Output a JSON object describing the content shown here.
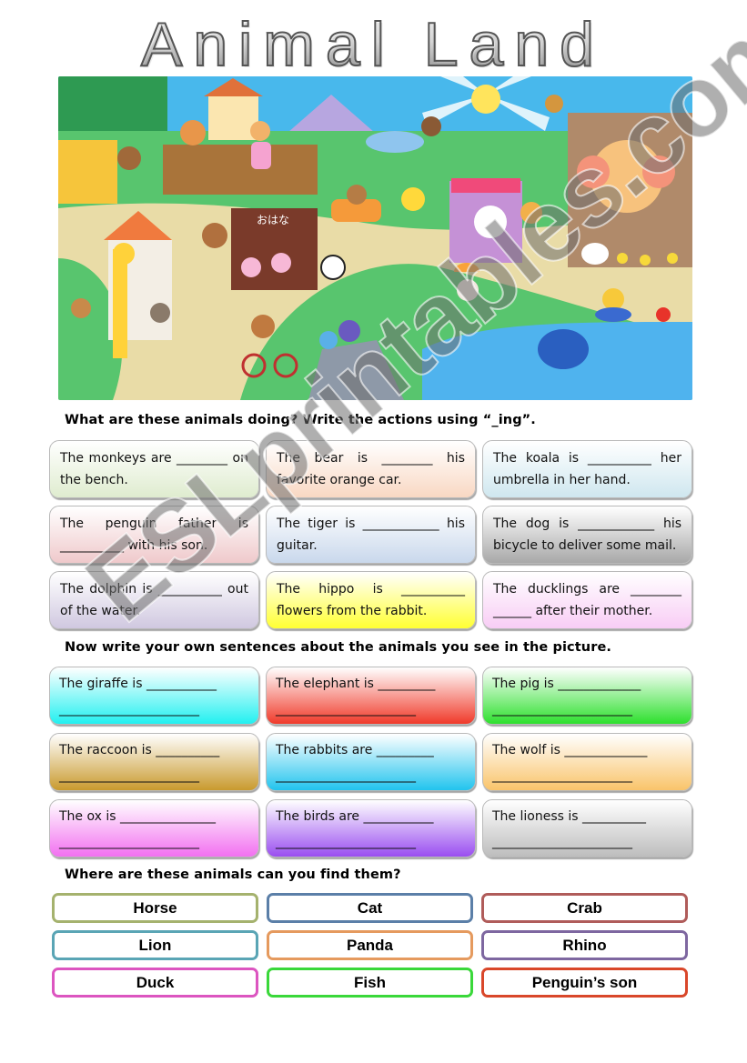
{
  "title": "Animal Land",
  "illustration": {
    "description": "Cartoon town scene with animals",
    "sign_text": "おはな"
  },
  "section1": {
    "heading": "What are these animals doing? Write the actions using “_ing”.",
    "cards": [
      {
        "text": "The monkeys are ________ on the bench.",
        "color": "#dfeccf"
      },
      {
        "text": "The bear is ________ his favorite orange car.",
        "color": "#f9d8c3"
      },
      {
        "text": "The koala is __________ her umbrella in her hand.",
        "color": "#cfe7ef"
      },
      {
        "text": "The penguin father is __________ with his son.",
        "color": "#efc9cb"
      },
      {
        "text": "The tiger is ____________ his guitar.",
        "color": "#c9d8ec"
      },
      {
        "text": "The dog is ____________ his bicycle to deliver some mail.",
        "color": "#a8a8a8"
      },
      {
        "text": "The dolphin is __________ out of the water.",
        "color": "#d0c8e0"
      },
      {
        "text": "The hippo is __________ flowers from the rabbit.",
        "color": "#ffff33"
      },
      {
        "text": "The ducklings are ________ ______ after their mother.",
        "color": "#f8cdf5"
      }
    ]
  },
  "section2": {
    "heading": "Now write your own sentences about the animals you see in the picture.",
    "cards": [
      {
        "line1": "The giraffe is ___________",
        "line2": "______________________",
        "color": "#22f0f0"
      },
      {
        "line1": "The elephant is _________",
        "line2": "______________________",
        "color": "#f03a2a"
      },
      {
        "line1": "The pig is _____________",
        "line2": "______________________",
        "color": "#2ee02e"
      },
      {
        "line1": "The raccoon is __________",
        "line2": "______________________",
        "color": "#c99a2e"
      },
      {
        "line1": "The rabbits are _________",
        "line2": "______________________",
        "color": "#22c4ee"
      },
      {
        "line1": "The wolf is _____________",
        "line2": "______________________",
        "color": "#f9c46a"
      },
      {
        "line1": "The ox is _______________",
        "line2": "______________________",
        "color": "#f270f0"
      },
      {
        "line1": "The birds are ___________",
        "line2": "______________________",
        "color": "#9a4ef0"
      },
      {
        "line1": "The lioness is __________",
        "line2": "______________________",
        "color": "#bdbdbd"
      }
    ]
  },
  "section3": {
    "heading": "Where are these animals can you find them?",
    "words": [
      {
        "label": "Horse",
        "border": "#a5b26e"
      },
      {
        "label": "Cat",
        "border": "#5b7fa8"
      },
      {
        "label": "Crab",
        "border": "#b05c5a"
      },
      {
        "label": "Lion",
        "border": "#5aa5b5"
      },
      {
        "label": "Panda",
        "border": "#e59a5e"
      },
      {
        "label": "Rhino",
        "border": "#7e67a0"
      },
      {
        "label": "Duck",
        "border": "#dc55c0"
      },
      {
        "label": "Fish",
        "border": "#3ad83a"
      },
      {
        "label": "Penguin’s son",
        "border": "#d9472a"
      }
    ]
  },
  "watermark": "ESLprintables.com"
}
